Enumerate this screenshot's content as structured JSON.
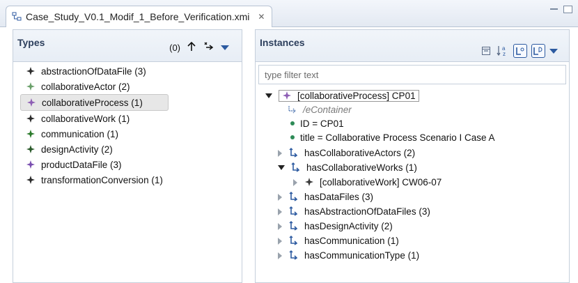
{
  "tab": {
    "title": "Case_Study_V0.1_Modif_1_Before_Verification.xmi",
    "close_glyph": "✕"
  },
  "types_panel": {
    "title": "Types",
    "count": "(0)",
    "items": [
      {
        "label": "abstractionOfDataFile (3)",
        "color": "#2b2b2b"
      },
      {
        "label": "collaborativeActor (2)",
        "color": "#6aa06a"
      },
      {
        "label": "collaborativeProcess (1)",
        "color": "#8e5fb5"
      },
      {
        "label": "collaborativeWork (1)",
        "color": "#2b2b2b"
      },
      {
        "label": "communication (1)",
        "color": "#2b7a2b"
      },
      {
        "label": "designActivity (2)",
        "color": "#2b5a2b"
      },
      {
        "label": "productDataFile (3)",
        "color": "#7a4fb0"
      },
      {
        "label": "transformationConversion (1)",
        "color": "#2b2b2b"
      }
    ]
  },
  "instances_panel": {
    "title": "Instances",
    "filter_placeholder": "type filter text",
    "tree": {
      "root": "[collaborativeProcess] CP01",
      "econtainer": "/eContainer",
      "id_attr": "ID = CP01",
      "title_attr": "title = Collaborative Process Scenario I Case A",
      "refs": [
        {
          "label": "hasCollaborativeActors (2)",
          "expanded": false
        },
        {
          "label": "hasCollaborativeWorks (1)",
          "expanded": true
        },
        {
          "label": "hasDataFiles (3)",
          "expanded": false
        },
        {
          "label": "hasAbstractionOfDataFiles (3)",
          "expanded": false
        },
        {
          "label": "hasDesignActivity (2)",
          "expanded": false
        },
        {
          "label": "hasCommunication (1)",
          "expanded": false
        },
        {
          "label": "hasCommunicationType (1)",
          "expanded": false
        }
      ],
      "child": "[collaborativeWork] CW06-07"
    }
  },
  "colors": {
    "accent": "#2c5aa0",
    "purple_diamond": "#8e5fb5",
    "attr_dot": "#2e8b57"
  }
}
